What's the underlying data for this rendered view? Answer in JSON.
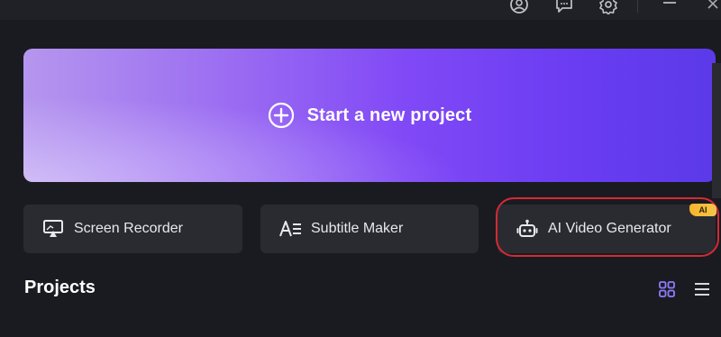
{
  "hero": {
    "label": "Start a new project"
  },
  "actions": [
    {
      "label": "Screen Recorder"
    },
    {
      "label": "Subtitle Maker"
    },
    {
      "label": "AI Video Generator",
      "badge": "AI"
    }
  ],
  "projects": {
    "title": "Projects"
  },
  "colors": {
    "background": "#1a1b20",
    "card": "#2a2b31",
    "hero_start": "#b596ee",
    "hero_end": "#5b3ae8",
    "highlight_outline": "#d42a36",
    "badge": "#f6b42b",
    "view_active": "#8e7bff"
  },
  "icons": {
    "titlebar": [
      "account-icon",
      "feedback-icon",
      "settings-icon",
      "minimize-icon",
      "close-icon"
    ],
    "hero": "plus-circle-icon",
    "actions": [
      "screen-recorder-icon",
      "subtitle-icon",
      "robot-icon"
    ],
    "views": [
      "grid-view-icon",
      "list-view-icon"
    ]
  }
}
